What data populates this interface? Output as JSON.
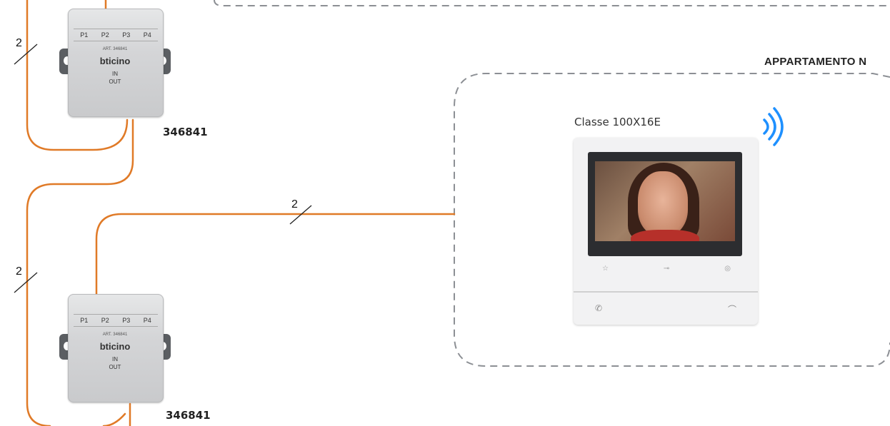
{
  "colors": {
    "wire": "#e07a27",
    "dash": "#8c8f94",
    "wifi": "#1e90ff"
  },
  "derivation_box_top": {
    "code": "346841",
    "ports": [
      "P1",
      "P2",
      "P3",
      "P4"
    ],
    "art": "ART. 346841",
    "brand": "bticino",
    "in_label": "IN",
    "out_label": "OUT"
  },
  "derivation_box_bottom": {
    "code": "346841",
    "ports": [
      "P1",
      "P2",
      "P3",
      "P4"
    ],
    "art": "ART. 346841",
    "brand": "bticino",
    "in_label": "IN",
    "out_label": "OUT"
  },
  "wire_counts": {
    "riser_top": "2",
    "riser_bottom": "2",
    "branch": "2"
  },
  "apartment": {
    "title": "APPARTAMENTO N",
    "device_model": "Classe 100X16E",
    "wifi_icon": "wifi-icon"
  }
}
